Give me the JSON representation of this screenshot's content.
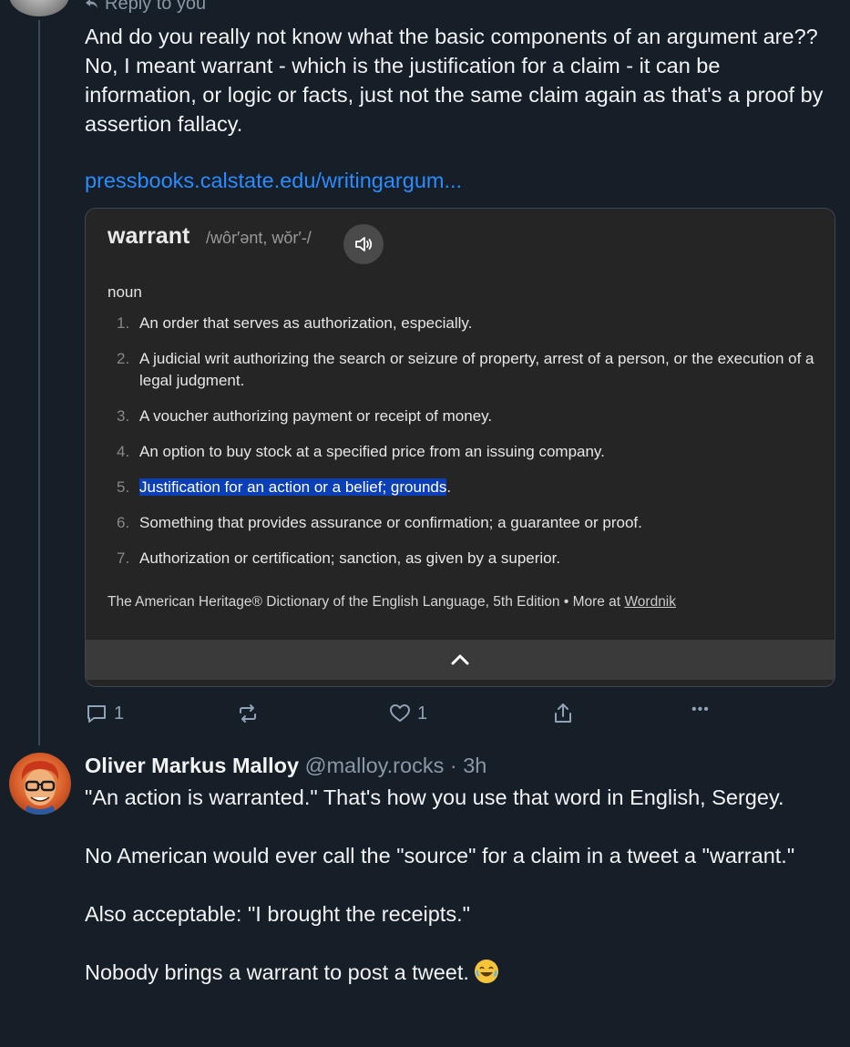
{
  "reply_indicator": "Reply to you",
  "post1": {
    "text": "And do you really not know what the basic components of an argument are??  No, I meant warrant - which is the justification for a claim - it can be information, or logic or facts, just not the same claim again as that's a proof by assertion fallacy.",
    "link": "pressbooks.calstate.edu/writingargum..."
  },
  "embed": {
    "word": "warrant",
    "pronunciation": "/wôr′ənt, wŏr′-/",
    "part_of_speech": "noun",
    "definitions": [
      {
        "num": "1.",
        "text": "An order that serves as authorization, especially."
      },
      {
        "num": "2.",
        "text": "A judicial writ authorizing the search or seizure of property, arrest of a person, or the execution of a legal judgment."
      },
      {
        "num": "3.",
        "text": "A voucher authorizing payment or receipt of money."
      },
      {
        "num": "4.",
        "text": "An option to buy stock at a specified price from an issuing company."
      },
      {
        "num": "5.",
        "text_highlighted": "Justification for an action or a belief; grounds",
        "text_after": "."
      },
      {
        "num": "6.",
        "text": "Something that provides assurance or confirmation; a guarantee or proof."
      },
      {
        "num": "7.",
        "text": "Authorization or certification; sanction, as given by a superior."
      }
    ],
    "source": "The American Heritage® Dictionary of the English Language, 5th Edition",
    "more_at": "More at",
    "wordnik": "Wordnik"
  },
  "actions": {
    "replies": "1",
    "likes": "1",
    "more": "•••"
  },
  "post2": {
    "author_name": "Oliver Markus Malloy",
    "handle": "@malloy.rocks",
    "time": "3h",
    "text": "\"An action is warranted.\" That's how you use that word in English, Sergey.\n\nNo American would ever call the \"source\" for a claim in a tweet a \"warrant.\"\n\nAlso acceptable: \"I brought the receipts.\"\n\nNobody brings a warrant to post a tweet."
  },
  "colors": {
    "background": "#161e27",
    "link": "#2a8cff",
    "muted": "#8a97a6",
    "highlight": "#0b3fb7"
  }
}
